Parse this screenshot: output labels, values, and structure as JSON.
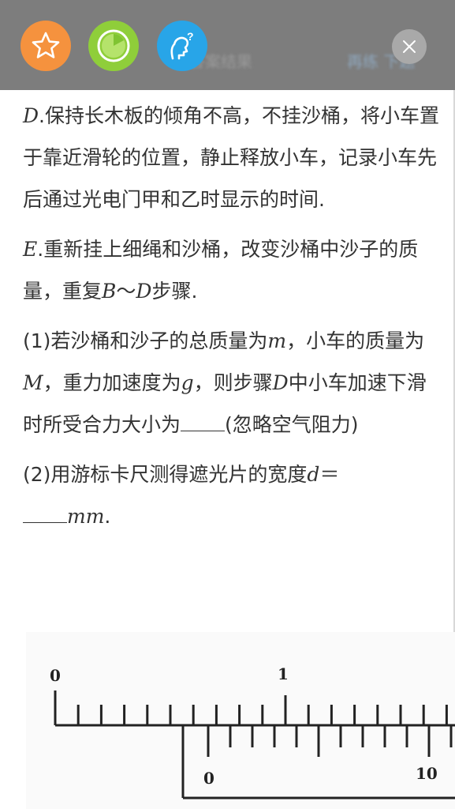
{
  "toolbar": {
    "favorite_icon": "star-icon",
    "timer_icon": "timer-icon",
    "help_icon": "help-person-icon",
    "close_icon": "close-icon",
    "colors": {
      "overlay": "#7d7d7d",
      "favorite": "#f5923e",
      "timer": "#8fce3a",
      "help": "#28a5e8",
      "close": "#a9a9a9"
    }
  },
  "content": {
    "step_d": {
      "letter": "D",
      "text": ".保持长木板的倾角不高，不挂沙桶，将小车置于靠近滑轮的位置，静止释放小车，记录小车先后通过光电门甲和乙时显示的时间."
    },
    "step_e": {
      "letter": "E",
      "text_a": ".重新挂上细绳和沙桶，改变沙桶中沙子的质量，重复",
      "var_b": "B",
      "tilde": "～",
      "var_d": "D",
      "text_b": "步骤."
    },
    "q1": {
      "t1": "(1)若沙桶和沙子的总质量为",
      "m": "m",
      "t2": "，小车的质量为",
      "M": "M",
      "t3": "，重力加速度为",
      "g": "g",
      "t4": "，则步骤",
      "D": "D",
      "t5": "中小车加速下滑时所受合力大小为",
      "t6": "(忽略空气阻力)"
    },
    "q2": {
      "t1": "(2)用游标卡尺测得遮光片的宽度",
      "d": "d",
      "eq": "＝",
      "unit": "mm",
      "period": "."
    }
  },
  "figure": {
    "main_scale_labels": [
      "0",
      "1"
    ],
    "vernier_scale_labels": [
      "0",
      "10"
    ]
  }
}
